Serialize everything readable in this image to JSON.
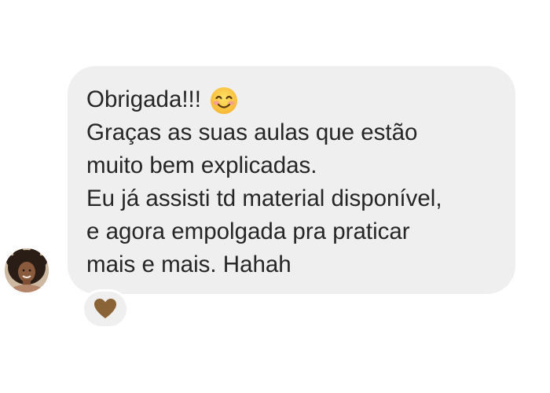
{
  "message": {
    "lines": [
      "Obrigada!!!",
      "Graças as suas aulas que estão",
      "muito bem explicadas.",
      "Eu já assisti td material disponível,",
      "e agora empolgada pra praticar",
      "mais e mais. Hahah"
    ],
    "emoji": "smiling-face-with-smiling-eyes"
  },
  "reaction": {
    "icon": "heart",
    "color": "#8a6336"
  },
  "colors": {
    "bubble": "#efefef",
    "text": "#262626",
    "background": "#ffffff"
  }
}
